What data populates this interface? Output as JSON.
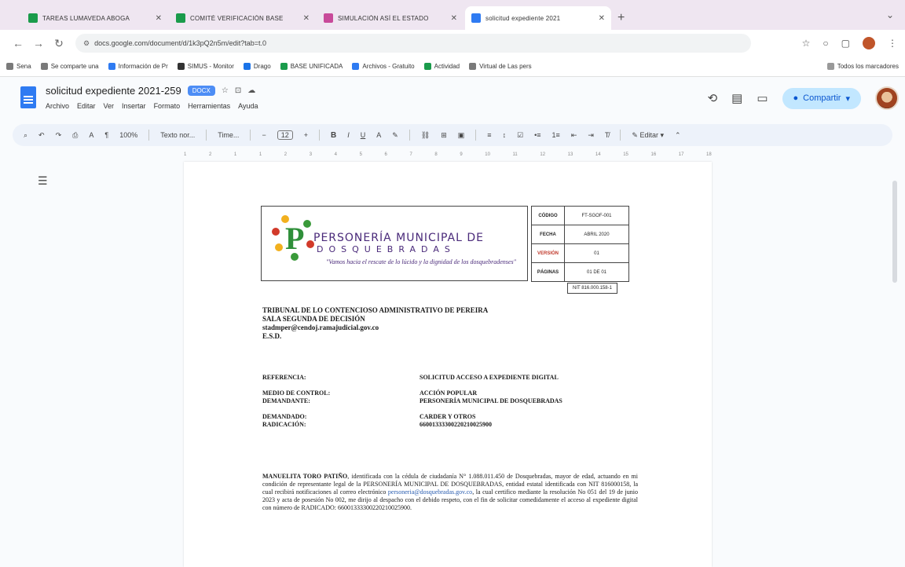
{
  "browser": {
    "tabs": [
      {
        "title": "TAREAS LUMAVEDA ABOGA",
        "color": "#1a9b4b",
        "active": false
      },
      {
        "title": "COMITÉ VERIFICACIÓN BASE",
        "color": "#1a9b4b",
        "active": false
      },
      {
        "title": "SIMULACIÓN ASÍ EL ESTADO",
        "color": "#c84a9a",
        "active": false
      },
      {
        "title": "solicitud expediente 2021",
        "color": "#2f7bf2",
        "active": true
      }
    ],
    "url": "docs.google.com/document/d/1k3pQ2n5m/edit?tab=t.0",
    "bookmarks": [
      {
        "label": "Sena",
        "color": "#7a7a7a"
      },
      {
        "label": "Se comparte una",
        "color": "#7a7a7a"
      },
      {
        "label": "Información de Pr",
        "color": "#2f7bf2"
      },
      {
        "label": "SIMUS - Monitor",
        "color": "#333"
      },
      {
        "label": "Drago",
        "color": "#1a73e8"
      },
      {
        "label": "BASE UNIFICADA",
        "color": "#1a9b4b"
      },
      {
        "label": "Archivos - Gratuito",
        "color": "#2f7bf2"
      },
      {
        "label": "Actividad",
        "color": "#1a9b4b"
      },
      {
        "label": "Virtual de Las pers",
        "color": "#7a7a7a"
      }
    ],
    "all_bookmarks": "Todos los marcadores"
  },
  "docs": {
    "title": "solicitud expediente 2021-259",
    "badge": "DOCX",
    "menu": [
      "Archivo",
      "Editar",
      "Ver",
      "Insertar",
      "Formato",
      "Herramientas",
      "Ayuda"
    ],
    "share_label": "Compartir",
    "toolbar": {
      "zoom": "100%",
      "style": "Texto nor...",
      "font": "Time...",
      "font_size": "12",
      "edit_mode": "Editar"
    },
    "ruler_marks": [
      "1",
      "2",
      "1",
      "1",
      "2",
      "3",
      "4",
      "5",
      "6",
      "7",
      "8",
      "9",
      "10",
      "11",
      "12",
      "13",
      "14",
      "15",
      "16",
      "17",
      "18"
    ]
  },
  "document": {
    "org_line1": "PERSONERÍA MUNICIPAL DE",
    "org_line2": "DOSQUEBRADAS",
    "motto": "\"Vamos hacia el rescate de lo lúcido y la dignidad de los dosquebradenses\"",
    "codes": [
      {
        "k": "CÓDIGO",
        "v": "FT-SGOF-001",
        "red": false
      },
      {
        "k": "FECHA",
        "v": "ABRIL 2020",
        "red": false
      },
      {
        "k": "VERSIÓN",
        "v": "01",
        "red": true
      },
      {
        "k": "PÁGINAS",
        "v": "01 DE 01",
        "red": false
      }
    ],
    "nit": "NIT 816.000.158-1",
    "addressee": [
      "TRIBUNAL DE LO CONTENCIOSO ADMINISTRATIVO DE PEREIRA",
      "SALA SEGUNDA DE DECISIÓN",
      "stadmper@cendoj.ramajudicial.gov.co",
      "E.S.D."
    ],
    "references": [
      {
        "k": "REFERENCIA:",
        "v": "SOLICITUD ACCESO A EXPEDIENTE DIGITAL"
      },
      {
        "k": "MEDIO DE CONTROL:",
        "v": "ACCIÓN POPULAR"
      },
      {
        "k": "DEMANDANTE:",
        "v": "PERSONERÍA MUNICIPAL DE DOSQUEBRADAS"
      },
      {
        "k": "DEMANDADO:",
        "v": "CARDER Y OTROS"
      },
      {
        "k": "RADICACIÓN:",
        "v": "66001333300220210025900"
      }
    ],
    "body_name": "MANUELITA TORO PATIÑO",
    "body_text": ", identificada con la cédula de ciudadanía N° 1.088.011.450 de Dosquebradas, mayor de edad, actuando en mi condición de representante legal de la PERSONERÍA MUNICIPAL DE DOSQUEBRADAS, entidad estatal identificada con NIT 816000158, la cual recibirá notificaciones al correo electrónico",
    "body_email": "personeria@dosquebradas.gov.co",
    "body_text2": ", la cual certifico mediante la resolución No 051 del 19 de junio 2023 y acta de posesión No 002, me dirijo al despacho con el debido respeto, con el fin de solicitar comedidamente el acceso al expediente digital con número de RADICADO: 66001333300220210025900."
  }
}
